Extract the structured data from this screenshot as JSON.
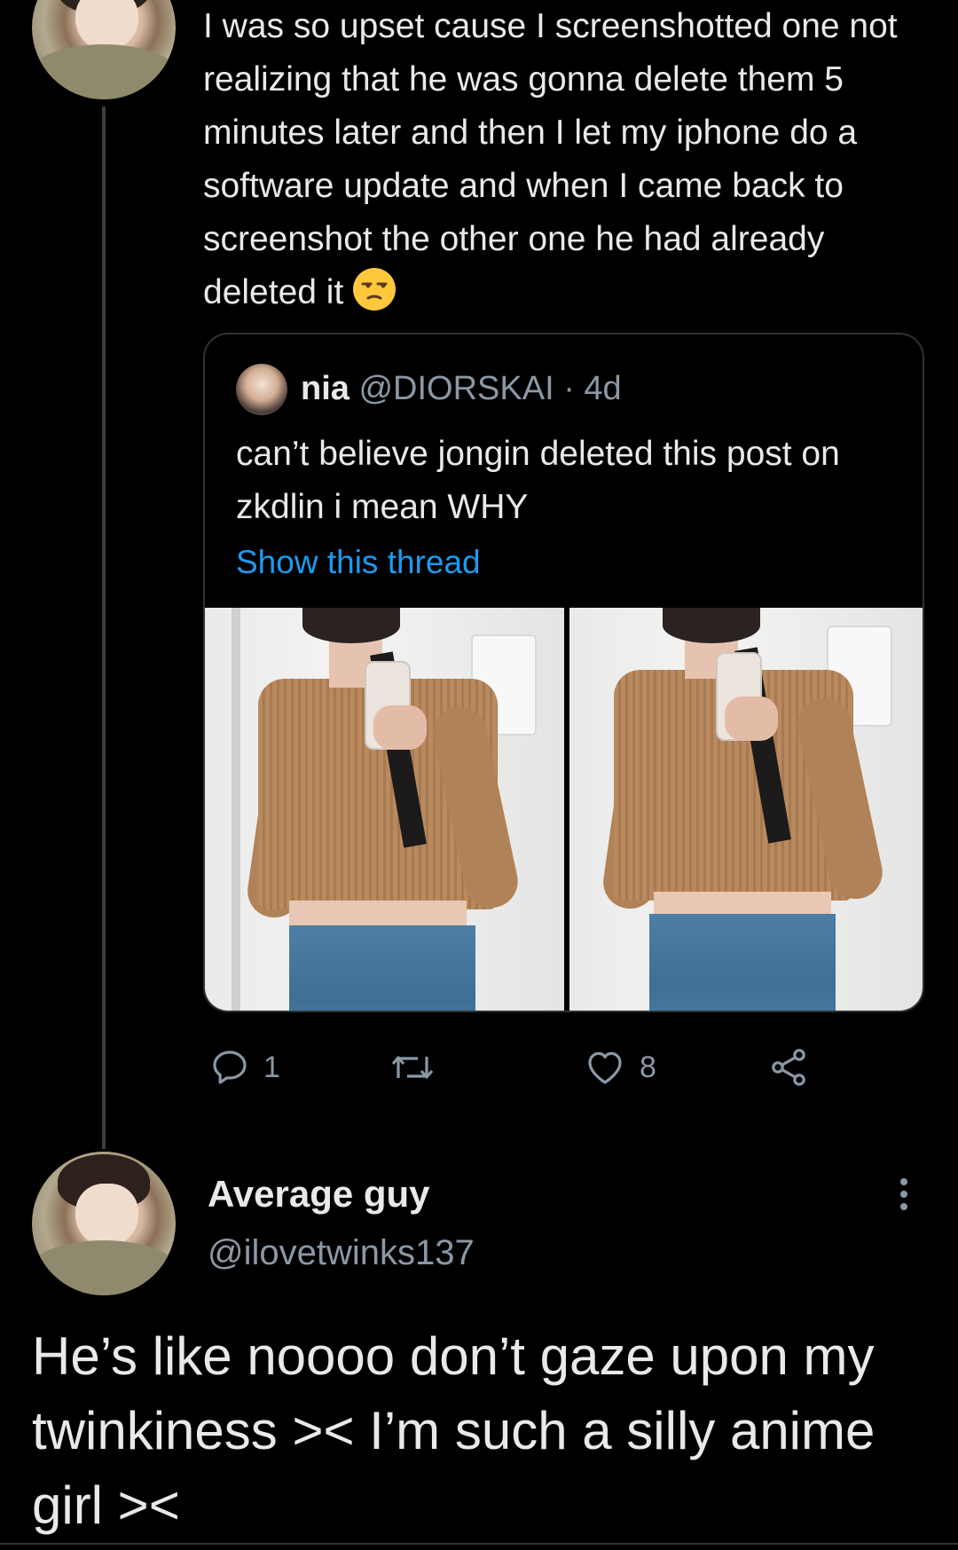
{
  "tweet_parent": {
    "text": "I was so upset cause I screenshotted one not realizing that he was gonna delete them 5 minutes later and then I let my iphone do a software update and when I came back to screenshot the other one he had already deleted it",
    "emoji": "unamused-face",
    "actions": {
      "reply_count": "1",
      "retweet_count": "",
      "like_count": "8"
    }
  },
  "quoted_tweet": {
    "name": "nia",
    "handle": "@DIORSKAI",
    "separator": "·",
    "time": "4d",
    "text": "can’t believe jongin deleted this post on zkdlin i mean WHY",
    "show_thread_label": "Show this thread",
    "images": [
      "mirror-selfie-photo",
      "mirror-selfie-photo"
    ]
  },
  "tweet_main": {
    "name": "Average guy",
    "handle": "@ilovetwinks137",
    "text": "He’s like noooo don’t gaze upon my twinkiness >< I’m such a silly anime girl ><"
  },
  "colors": {
    "background": "#000000",
    "text": "#e7e9ea",
    "secondary": "#8b98a5",
    "link": "#1d9bf0",
    "border": "#2f3336"
  }
}
